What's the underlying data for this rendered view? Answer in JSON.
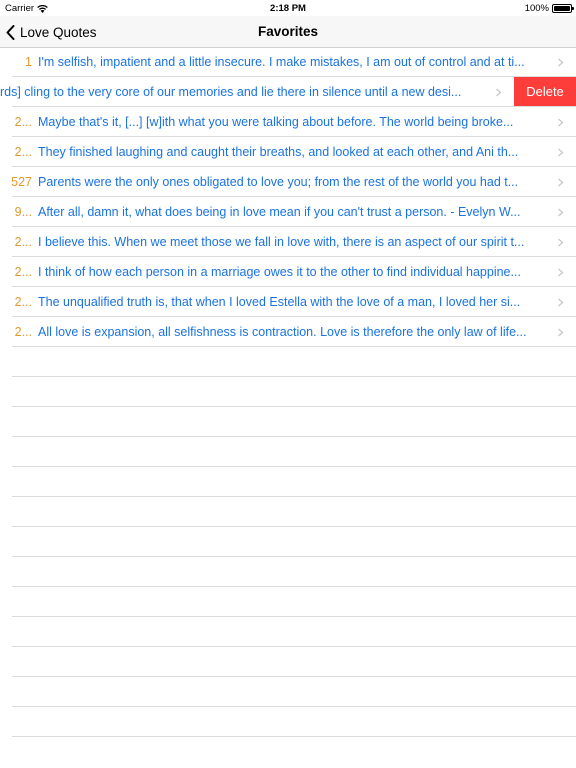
{
  "status_bar": {
    "carrier": "Carrier",
    "time": "2:18 PM",
    "battery": "100%"
  },
  "nav": {
    "back_label": "Love Quotes",
    "title": "Favorites"
  },
  "swiped_row": {
    "quote": "rds] cling to the very core of our memories and lie there in silence until a new desi...",
    "delete_label": "Delete"
  },
  "rows": [
    {
      "num": "1",
      "quote": "I'm selfish, impatient and a little insecure. I make mistakes, I am out of control and at ti..."
    },
    {
      "num": "2...",
      "quote": "Maybe that's it, [...] [w]ith what you were talking about before. The world being broke..."
    },
    {
      "num": "2...",
      "quote": "They finished laughing and caught their breaths, and looked at each other, and Ani th..."
    },
    {
      "num": "527",
      "quote": "Parents were the only ones obligated to love you; from the rest of the world you had t..."
    },
    {
      "num": "9...",
      "quote": "After all, damn it, what does being in love mean if you can't trust a person. - Evelyn W..."
    },
    {
      "num": "2...",
      "quote": "I believe this. When we meet those we fall in love with, there is an aspect of our spirit t..."
    },
    {
      "num": "2...",
      "quote": "I think of how each person in a marriage owes it to the other to find individual happine..."
    },
    {
      "num": "2...",
      "quote": "The unqualified truth is, that when I loved Estella with the love of a man, I loved her si..."
    },
    {
      "num": "2...",
      "quote": "All love is expansion, all selfishness is contraction. Love is therefore the only law of life..."
    }
  ]
}
